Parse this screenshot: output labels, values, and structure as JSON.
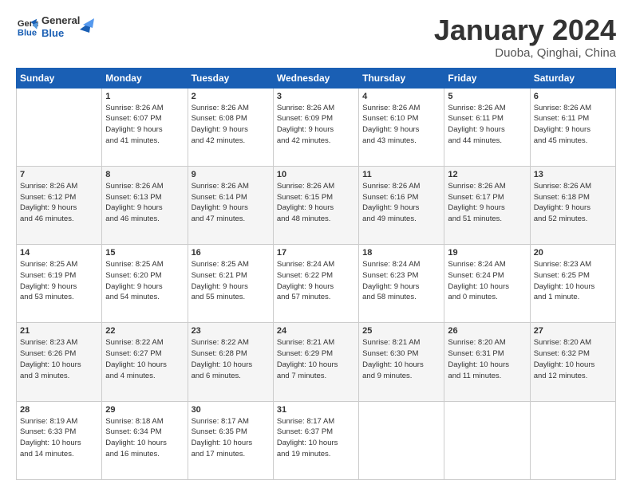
{
  "logo": {
    "line1": "General",
    "line2": "Blue"
  },
  "header": {
    "title": "January 2024",
    "subtitle": "Duoba, Qinghai, China"
  },
  "weekdays": [
    "Sunday",
    "Monday",
    "Tuesday",
    "Wednesday",
    "Thursday",
    "Friday",
    "Saturday"
  ],
  "weeks": [
    [
      {
        "day": "",
        "info": ""
      },
      {
        "day": "1",
        "info": "Sunrise: 8:26 AM\nSunset: 6:07 PM\nDaylight: 9 hours\nand 41 minutes."
      },
      {
        "day": "2",
        "info": "Sunrise: 8:26 AM\nSunset: 6:08 PM\nDaylight: 9 hours\nand 42 minutes."
      },
      {
        "day": "3",
        "info": "Sunrise: 8:26 AM\nSunset: 6:09 PM\nDaylight: 9 hours\nand 42 minutes."
      },
      {
        "day": "4",
        "info": "Sunrise: 8:26 AM\nSunset: 6:10 PM\nDaylight: 9 hours\nand 43 minutes."
      },
      {
        "day": "5",
        "info": "Sunrise: 8:26 AM\nSunset: 6:11 PM\nDaylight: 9 hours\nand 44 minutes."
      },
      {
        "day": "6",
        "info": "Sunrise: 8:26 AM\nSunset: 6:11 PM\nDaylight: 9 hours\nand 45 minutes."
      }
    ],
    [
      {
        "day": "7",
        "info": "Sunrise: 8:26 AM\nSunset: 6:12 PM\nDaylight: 9 hours\nand 46 minutes."
      },
      {
        "day": "8",
        "info": "Sunrise: 8:26 AM\nSunset: 6:13 PM\nDaylight: 9 hours\nand 46 minutes."
      },
      {
        "day": "9",
        "info": "Sunrise: 8:26 AM\nSunset: 6:14 PM\nDaylight: 9 hours\nand 47 minutes."
      },
      {
        "day": "10",
        "info": "Sunrise: 8:26 AM\nSunset: 6:15 PM\nDaylight: 9 hours\nand 48 minutes."
      },
      {
        "day": "11",
        "info": "Sunrise: 8:26 AM\nSunset: 6:16 PM\nDaylight: 9 hours\nand 49 minutes."
      },
      {
        "day": "12",
        "info": "Sunrise: 8:26 AM\nSunset: 6:17 PM\nDaylight: 9 hours\nand 51 minutes."
      },
      {
        "day": "13",
        "info": "Sunrise: 8:26 AM\nSunset: 6:18 PM\nDaylight: 9 hours\nand 52 minutes."
      }
    ],
    [
      {
        "day": "14",
        "info": "Sunrise: 8:25 AM\nSunset: 6:19 PM\nDaylight: 9 hours\nand 53 minutes."
      },
      {
        "day": "15",
        "info": "Sunrise: 8:25 AM\nSunset: 6:20 PM\nDaylight: 9 hours\nand 54 minutes."
      },
      {
        "day": "16",
        "info": "Sunrise: 8:25 AM\nSunset: 6:21 PM\nDaylight: 9 hours\nand 55 minutes."
      },
      {
        "day": "17",
        "info": "Sunrise: 8:24 AM\nSunset: 6:22 PM\nDaylight: 9 hours\nand 57 minutes."
      },
      {
        "day": "18",
        "info": "Sunrise: 8:24 AM\nSunset: 6:23 PM\nDaylight: 9 hours\nand 58 minutes."
      },
      {
        "day": "19",
        "info": "Sunrise: 8:24 AM\nSunset: 6:24 PM\nDaylight: 10 hours\nand 0 minutes."
      },
      {
        "day": "20",
        "info": "Sunrise: 8:23 AM\nSunset: 6:25 PM\nDaylight: 10 hours\nand 1 minute."
      }
    ],
    [
      {
        "day": "21",
        "info": "Sunrise: 8:23 AM\nSunset: 6:26 PM\nDaylight: 10 hours\nand 3 minutes."
      },
      {
        "day": "22",
        "info": "Sunrise: 8:22 AM\nSunset: 6:27 PM\nDaylight: 10 hours\nand 4 minutes."
      },
      {
        "day": "23",
        "info": "Sunrise: 8:22 AM\nSunset: 6:28 PM\nDaylight: 10 hours\nand 6 minutes."
      },
      {
        "day": "24",
        "info": "Sunrise: 8:21 AM\nSunset: 6:29 PM\nDaylight: 10 hours\nand 7 minutes."
      },
      {
        "day": "25",
        "info": "Sunrise: 8:21 AM\nSunset: 6:30 PM\nDaylight: 10 hours\nand 9 minutes."
      },
      {
        "day": "26",
        "info": "Sunrise: 8:20 AM\nSunset: 6:31 PM\nDaylight: 10 hours\nand 11 minutes."
      },
      {
        "day": "27",
        "info": "Sunrise: 8:20 AM\nSunset: 6:32 PM\nDaylight: 10 hours\nand 12 minutes."
      }
    ],
    [
      {
        "day": "28",
        "info": "Sunrise: 8:19 AM\nSunset: 6:33 PM\nDaylight: 10 hours\nand 14 minutes."
      },
      {
        "day": "29",
        "info": "Sunrise: 8:18 AM\nSunset: 6:34 PM\nDaylight: 10 hours\nand 16 minutes."
      },
      {
        "day": "30",
        "info": "Sunrise: 8:17 AM\nSunset: 6:35 PM\nDaylight: 10 hours\nand 17 minutes."
      },
      {
        "day": "31",
        "info": "Sunrise: 8:17 AM\nSunset: 6:37 PM\nDaylight: 10 hours\nand 19 minutes."
      },
      {
        "day": "",
        "info": ""
      },
      {
        "day": "",
        "info": ""
      },
      {
        "day": "",
        "info": ""
      }
    ]
  ]
}
